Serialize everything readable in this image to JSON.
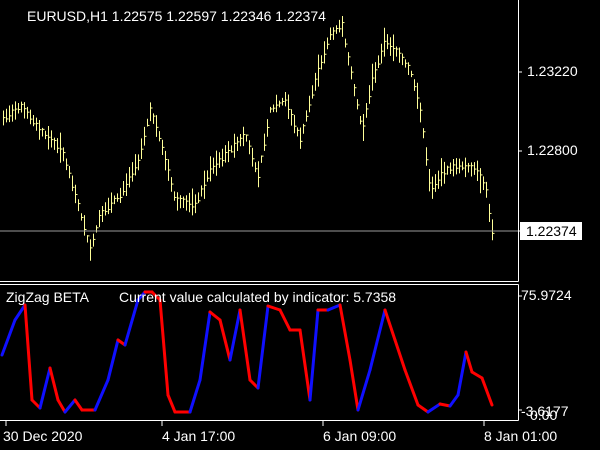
{
  "chart": {
    "symbol_header": "EURUSD,H1  1.22575 1.22597 1.22346 1.22374",
    "price_ticks": [
      "1.23220",
      "1.22800"
    ],
    "current_price": "1.22374",
    "time_ticks": [
      "30 Dec 2020",
      "4 Jan 17:00",
      "6 Jan 09:00",
      "8 Jan 01:00"
    ],
    "colors": {
      "background": "#000000",
      "bars": "#ffff99",
      "frame": "#ffffff",
      "zigzag_up": "#1010ff",
      "zigzag_down": "#ff0000"
    }
  },
  "indicator": {
    "name": "ZigZag BETA",
    "current_text": "Current value calculated by indicator: 5.7358",
    "scale_max": "75.9724",
    "scale_min": "-3.6177",
    "scale_zero": "0.00"
  }
}
